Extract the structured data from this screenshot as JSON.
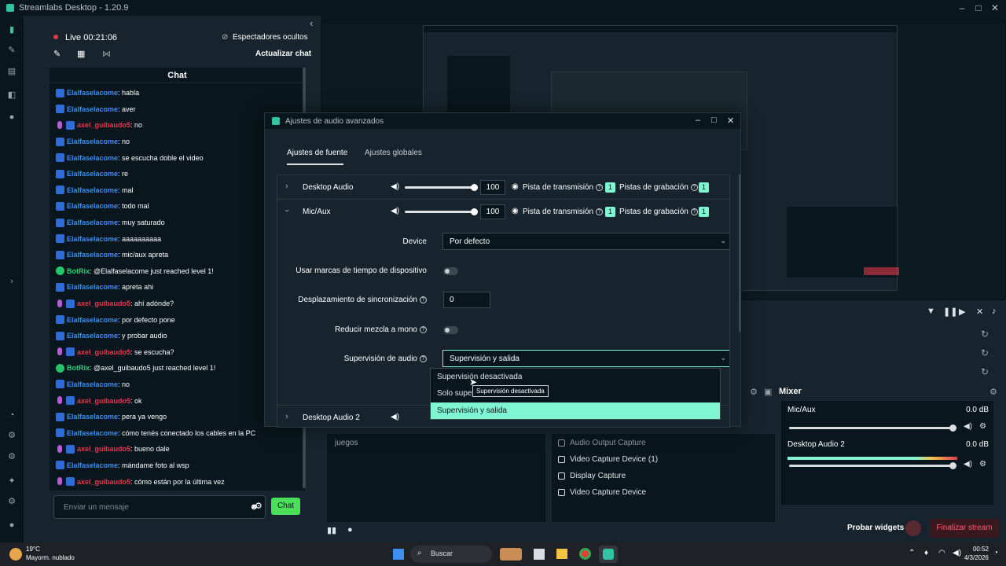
{
  "app": {
    "title": "Streamlabs Desktop - 1.20.9"
  },
  "chat": {
    "live": "Live 00:21:06",
    "viewers_hidden": "Espectadores ocultos",
    "refresh": "Actualizar chat",
    "title": "Chat",
    "input_placeholder": "Enviar un mensaje",
    "send_label": "Chat",
    "messages": [
      {
        "user": "Elalfaselacome",
        "text": ": habla",
        "badge": "blue",
        "color": "#3d8ef0"
      },
      {
        "user": "Elalfaselacome",
        "text": ": aver",
        "badge": "blue",
        "color": "#3d8ef0"
      },
      {
        "user": "axel_guibaudo5",
        "text": ": no",
        "badge": "mic",
        "color": "#e23a4c"
      },
      {
        "user": "Elalfaselacome",
        "text": ": no",
        "badge": "blue",
        "color": "#3d8ef0"
      },
      {
        "user": "Elalfaselacome",
        "text": ": se escucha doble el video",
        "badge": "blue",
        "color": "#3d8ef0"
      },
      {
        "user": "Elalfaselacome",
        "text": ": re",
        "badge": "blue",
        "color": "#3d8ef0"
      },
      {
        "user": "Elalfaselacome",
        "text": ": mal",
        "badge": "blue",
        "color": "#3d8ef0"
      },
      {
        "user": "Elalfaselacome",
        "text": ": todo mal",
        "badge": "blue",
        "color": "#3d8ef0"
      },
      {
        "user": "Elalfaselacome",
        "text": ": muy saturado",
        "badge": "blue",
        "color": "#3d8ef0"
      },
      {
        "user": "Elalfaselacome",
        "text": ": aaaaaaaaaa",
        "badge": "blue",
        "color": "#3d8ef0"
      },
      {
        "user": "Elalfaselacome",
        "text": ": mic/aux apreta",
        "badge": "blue",
        "color": "#3d8ef0"
      },
      {
        "user": "BotRix",
        "text": ": @Elalfaselacome just reached level 1!",
        "badge": "bot",
        "color": "#2fd07a"
      },
      {
        "user": "Elalfaselacome",
        "text": ": apreta ahi",
        "badge": "blue",
        "color": "#3d8ef0"
      },
      {
        "user": "axel_guibaudo5",
        "text": ": ahí adónde?",
        "badge": "mic",
        "color": "#e23a4c"
      },
      {
        "user": "Elalfaselacome",
        "text": ": por defecto pone",
        "badge": "blue",
        "color": "#3d8ef0"
      },
      {
        "user": "Elalfaselacome",
        "text": ": y probar audio",
        "badge": "blue",
        "color": "#3d8ef0"
      },
      {
        "user": "axel_guibaudo5",
        "text": ": se escucha?",
        "badge": "mic",
        "color": "#e23a4c"
      },
      {
        "user": "BotRix",
        "text": ": @axel_guibaudo5 just reached level 1!",
        "badge": "bot",
        "color": "#2fd07a"
      },
      {
        "user": "Elalfaselacome",
        "text": ": no",
        "badge": "blue",
        "color": "#3d8ef0"
      },
      {
        "user": "axel_guibaudo5",
        "text": ": ok",
        "badge": "mic",
        "color": "#e23a4c"
      },
      {
        "user": "Elalfaselacome",
        "text": ": pera ya vengo",
        "badge": "blue",
        "color": "#3d8ef0"
      },
      {
        "user": "Elalfaselacome",
        "text": ": cómo tenés conectado los cables en la PC",
        "badge": "blue",
        "color": "#3d8ef0"
      },
      {
        "user": "axel_guibaudo5",
        "text": ": bueno dale",
        "badge": "mic",
        "color": "#e23a4c"
      },
      {
        "user": "Elalfaselacome",
        "text": ": mándame foto al wsp",
        "badge": "blue",
        "color": "#3d8ef0"
      },
      {
        "user": "axel_guibaudo5",
        "text": ": cómo están por la última vez",
        "badge": "mic",
        "color": "#e23a4c"
      }
    ]
  },
  "dialog": {
    "title": "Ajustes de audio avanzados",
    "tab_source": "Ajustes de fuente",
    "tab_global": "Ajustes globales",
    "sources": [
      {
        "name": "Desktop Audio",
        "volume": "100",
        "stream_track": "Pista de transmisión",
        "stream_count": "1",
        "rec_track": "Pistas de grabación",
        "rec_count": "1",
        "vol_fraction": 1
      },
      {
        "name": "Mic/Aux",
        "volume": "100",
        "stream_track": "Pista de transmisión",
        "stream_count": "1",
        "rec_track": "Pistas de grabación",
        "rec_count": "1",
        "vol_fraction": 1
      }
    ],
    "device_label": "Device",
    "device_value": "Por defecto",
    "timestamps_label": "Usar marcas de tiempo de dispositivo",
    "sync_label": "Desplazamiento de sincronización",
    "sync_value": "0",
    "mono_label": "Reducir mezcla a mono",
    "monitor_label": "Supervisión de audio",
    "monitor_value": "Supervisión y salida",
    "options": [
      "Supervisión desactivada",
      "Solo supervisión",
      "Supervisión y salida"
    ],
    "option_partial": "Solo super",
    "tooltip": "Supervisión desactivada",
    "next_source": "Desktop Audio 2"
  },
  "dock": {
    "mixer_title": "Mixer",
    "scene_item": "juegos",
    "sources": [
      "Audio Output Capture",
      "Video Capture Device (1)",
      "Display Capture",
      "Video Capture Device"
    ],
    "mixer": [
      {
        "name": "Mic/Aux",
        "db": "0.0 dB"
      },
      {
        "name": "Desktop Audio 2",
        "db": "0.0 dB"
      }
    ],
    "test_widgets": "Probar widgets",
    "end_stream": "Finalizar stream"
  },
  "taskbar": {
    "weather_temp": "19°C",
    "weather_desc": "Mayorm. nublado",
    "search": "Buscar",
    "time": "00:52",
    "date": "4/3/2026"
  },
  "colors": {
    "accent": "#80f5d2",
    "danger": "#e23a4c"
  }
}
